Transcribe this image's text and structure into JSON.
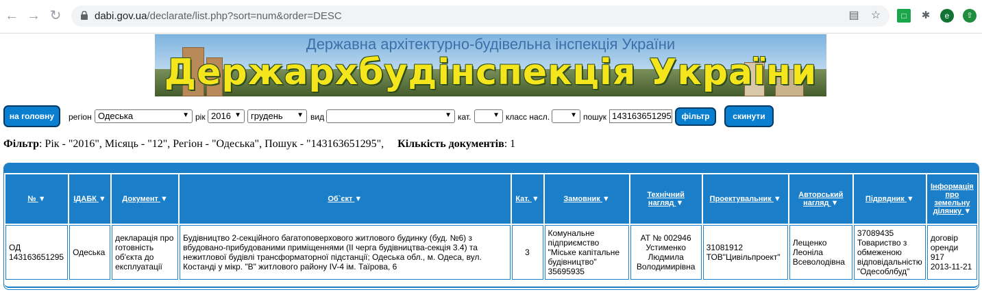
{
  "browser": {
    "url_host": "dabi.gov.ua",
    "url_path": "/declarate/list.php?sort=num&order=DESC",
    "profile_initial": "e"
  },
  "banner": {
    "subtitle": "Державна архітектурно-будівельна інспекція України",
    "title": "Держархбудінспекція України"
  },
  "filters": {
    "home_label": "на головну",
    "region_label": "регіон",
    "region_value": "Одеська",
    "year_label": "рік",
    "year_value": "2016",
    "month_value": "грудень",
    "type_label": "вид",
    "type_value": "",
    "cat_label": "кат.",
    "cat_value": "",
    "class_label": "класс насл.",
    "class_value": "",
    "search_label": "пошук",
    "search_value": "143163651295",
    "filter_button": "фільтр",
    "reset_button": "скинути"
  },
  "summary": {
    "filter_title": "Фільтр",
    "filter_text": ": Рік - \"2016\", Місяць - \"12\", Регіон - \"Одеська\", Пошук - \"143163651295\",",
    "count_title": "Кількість документів",
    "count_value": ": 1"
  },
  "table": {
    "headers": {
      "num": "№",
      "idabk": "ІДАБК",
      "document": "Документ",
      "object": "Об`єкт",
      "cat": "Кат.",
      "customer": "Замовник",
      "tech1": "Технічний",
      "tech2": "нагляд",
      "designer": "Проектувальник",
      "author1": "Авторський",
      "author2": "нагляд",
      "contractor": "Підрядник",
      "land1": "Інформація",
      "land2": "про",
      "land3": "земельну",
      "land4": "ділянку"
    },
    "row": {
      "num1": "ОД",
      "num2": "143163651295",
      "idabk": "Одеська",
      "document": "декларація про готовність об'єкта до експлуатації",
      "object": "Будівництво 2-секційного багатоповерхового житлового будинку (буд. №6) з вбудовано-прибудованими приміщеннями (ІІ черга будівництва-секція 3.4) та нежитлової будівлі трансформаторної підстанції; Одеська обл., м. Одеса, вул. Костанді у мікр. \"В\" житлового району IV-4 ім. Таїрова, 6",
      "cat": "3",
      "customer": "Комунальне підприємство \"Міське капітальне будівництво\" 35695935",
      "tech1": "АТ № 002946",
      "tech2": "Устименко Людмила Володимирівна",
      "designer1": "31081912",
      "designer2": "ТОВ\"Цивільпроект\"",
      "author": "Лещенко Леоніла Всеволодівна",
      "contractor1": "37089435",
      "contractor2": "Товариство з обмеженою відповідальністю \"Одесоблбуд\"",
      "land1": "договір оренди 917",
      "land2": "2013-11-21"
    }
  }
}
